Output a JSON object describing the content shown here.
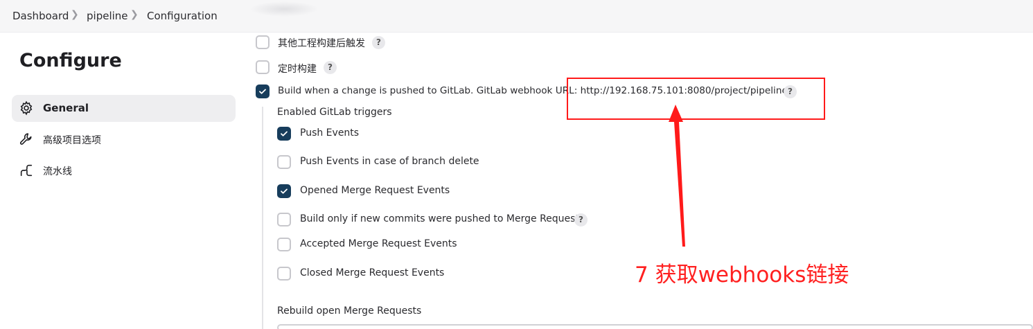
{
  "breadcrumb": {
    "items": [
      "Dashboard",
      "pipeline",
      "Configuration"
    ]
  },
  "sidebar": {
    "title": "Configure",
    "items": [
      {
        "label": "General",
        "icon": "gear-icon",
        "active": true
      },
      {
        "label": "高级项目选项",
        "icon": "wrench-icon",
        "active": false
      },
      {
        "label": "流水线",
        "icon": "pipeline-icon",
        "active": false
      }
    ]
  },
  "triggers": {
    "other_projects": {
      "label": "其他工程构建后触发",
      "checked": false
    },
    "periodic": {
      "label": "定时构建",
      "checked": false
    },
    "gitlab": {
      "label": "Build when a change is pushed to GitLab. GitLab webhook URL: http://192.168.75.101:8080/project/pipeline",
      "checked": true
    }
  },
  "gitlab_triggers": {
    "heading": "Enabled GitLab triggers",
    "options": [
      {
        "label": "Push Events",
        "checked": true
      },
      {
        "label": "Push Events in case of branch delete",
        "checked": false
      },
      {
        "label": "Opened Merge Request Events",
        "checked": true
      },
      {
        "label": "Build only if new commits were pushed to Merge Request",
        "checked": false,
        "help": true
      },
      {
        "label": "Accepted Merge Request Events",
        "checked": false
      },
      {
        "label": "Closed Merge Request Events",
        "checked": false
      }
    ],
    "rebuild_label": "Rebuild open Merge Requests"
  },
  "help_glyph": "?",
  "annotation": {
    "text": "7 获取webhooks链接",
    "color": "#ff2020"
  },
  "colors": {
    "checked": "#173d5c",
    "sidebar_active": "#eeeef0",
    "annotation": "#ff1a1a"
  }
}
